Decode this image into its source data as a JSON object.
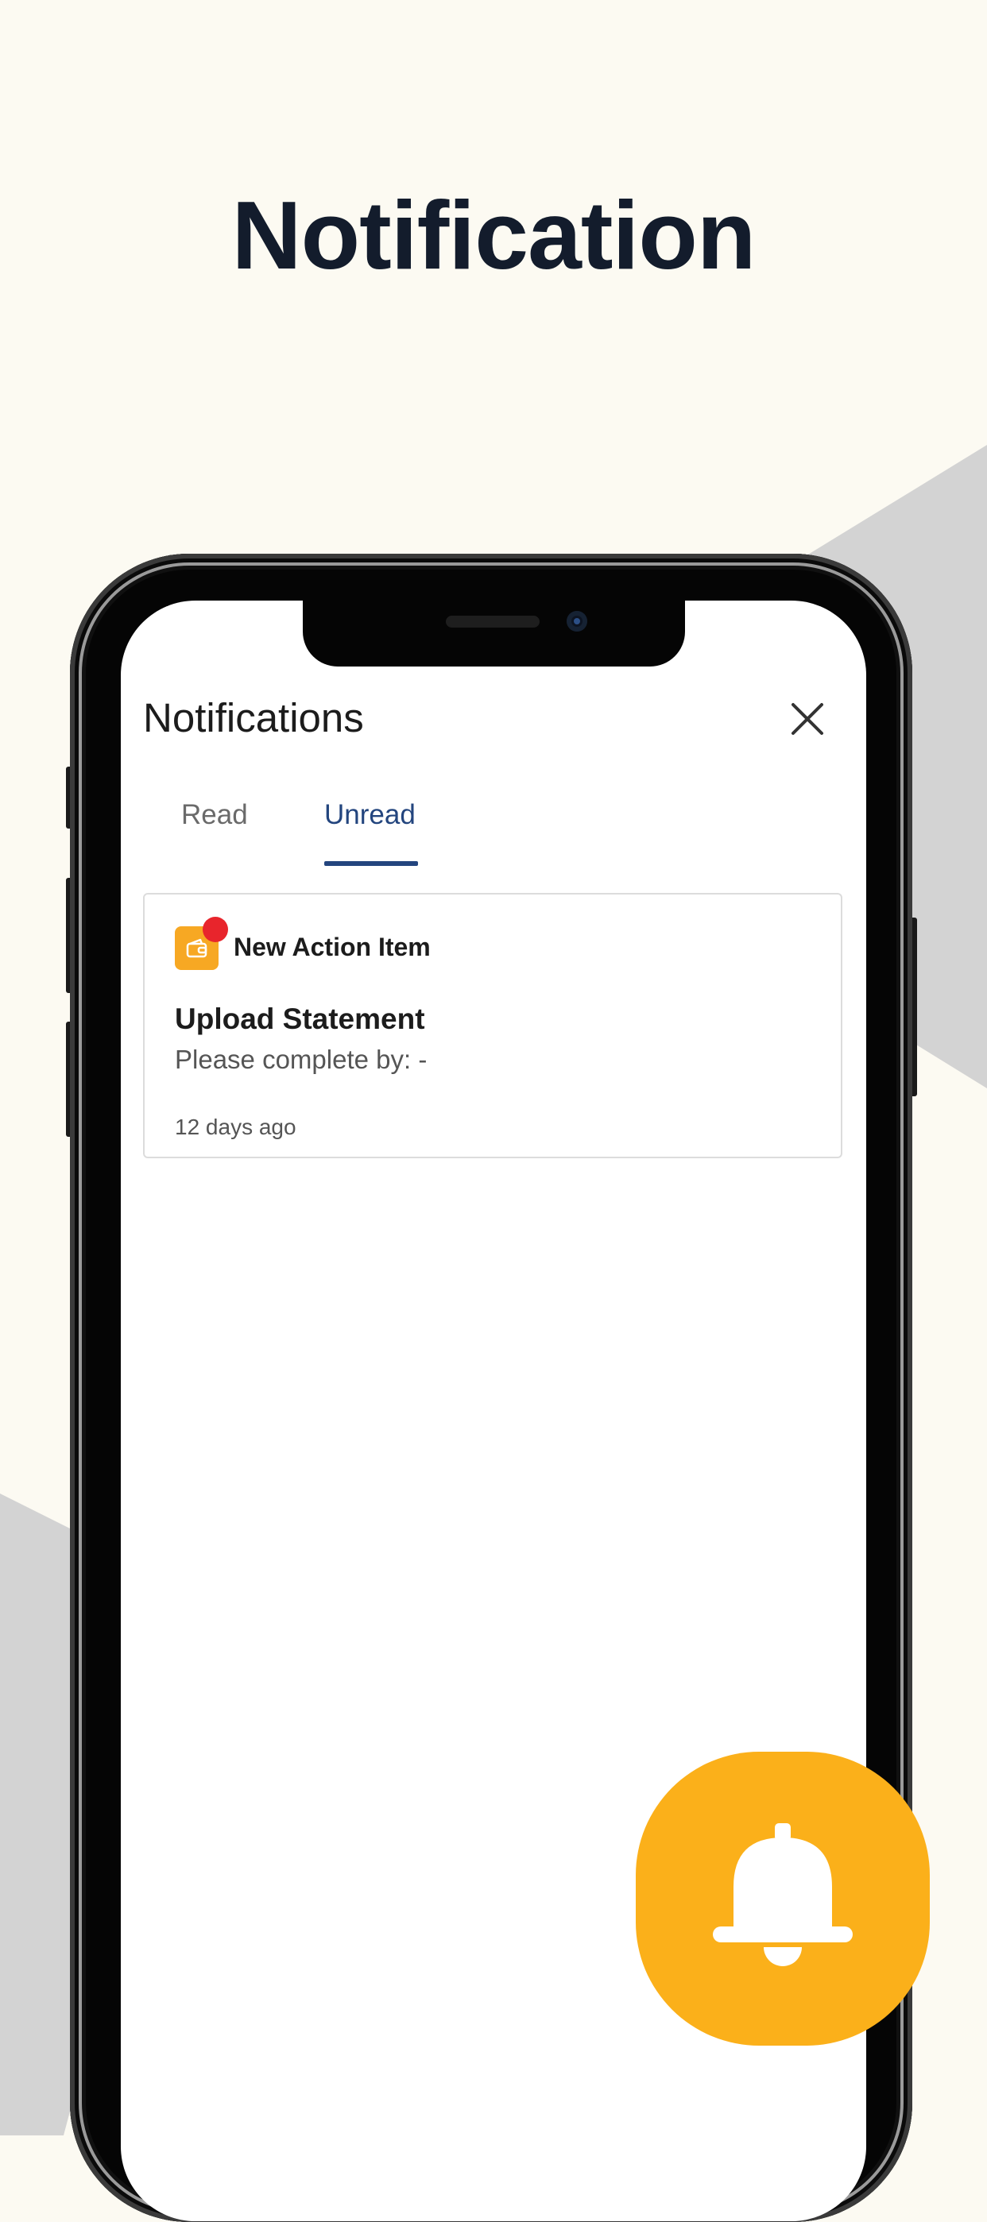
{
  "page": {
    "headline": "Notification",
    "background_color": "#FCFAF2",
    "shape_color": "#D3D3D3"
  },
  "app": {
    "title": "Notifications",
    "close_icon": "close-icon",
    "tabs": [
      {
        "label": "Read",
        "active": false
      },
      {
        "label": "Unread",
        "active": true
      }
    ],
    "accent_color": "#23457E"
  },
  "notifications": [
    {
      "type": "New Action Item",
      "icon": "wallet-icon",
      "icon_color": "#F7A823",
      "unread_badge_color": "#E8252C",
      "title": "Upload Statement",
      "description": "Please complete by: -",
      "time": "12 days ago"
    }
  ],
  "badge": {
    "icon": "bell-icon",
    "color": "#FBB01A"
  }
}
